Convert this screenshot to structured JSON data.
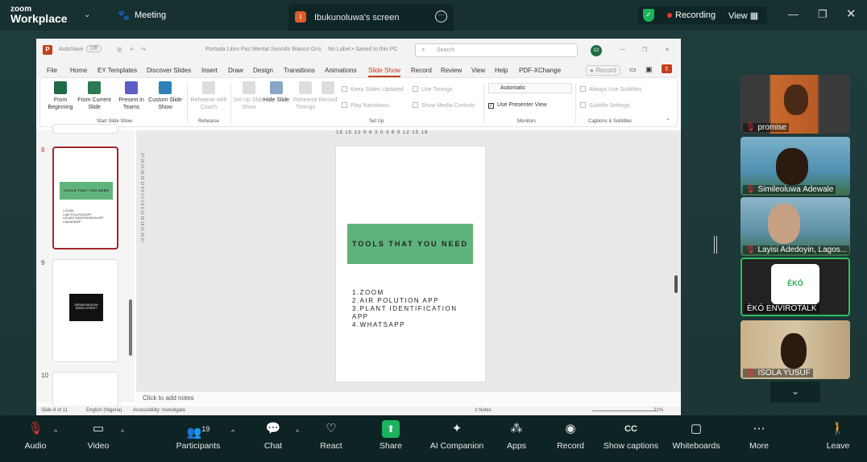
{
  "zoom": {
    "logo_line1": "zoom",
    "logo_line2": "Workplace",
    "meeting_label": "Meeting",
    "share_tab_title": "Ibukunoluwa's screen",
    "share_tab_initial": "I",
    "recording_label": "Recording",
    "view_label": "View"
  },
  "ppt": {
    "autosave": "AutoSave",
    "autosave_state": "Off",
    "doc_title": "Portada Libro Paz Mental Sencillo Blanco Gris",
    "label_status": "No Label • Saved to this PC",
    "search_placeholder": "Search",
    "user_initials": "IO",
    "record_btn": "Record",
    "menus": [
      "File",
      "Home",
      "EY Templates",
      "Discover Slides",
      "Insert",
      "Draw",
      "Design",
      "Transitions",
      "Animations",
      "Slide Show",
      "Record",
      "Review",
      "View",
      "Help",
      "PDF-XChange"
    ],
    "active_menu": "Slide Show",
    "ribbon": {
      "from_beginning": "From Beginning",
      "from_current": "From Current Slide",
      "present_teams": "Present in Teams",
      "custom_show": "Custom Slide Show",
      "group_start": "Start Slide Show",
      "rehearse_coach": "Rehearse with Coach",
      "group_rehearse": "Rehearse",
      "setup_show": "Set Up Slide Show",
      "hide_slide": "Hide Slide",
      "rehearse_timings": "Rehearse Timings",
      "record": "Record",
      "keep_updated": "Keep Slides Updated",
      "play_narrations": "Play Narrations",
      "use_timings": "Use Timings",
      "show_media": "Show Media Controls",
      "group_setup": "Set Up",
      "monitor_select": "Automatic",
      "presenter_view": "Use Presenter View",
      "group_monitors": "Monitors",
      "always_subtitles": "Always Use Subtitles",
      "subtitle_settings": "Subtitle Settings",
      "group_captions": "Captions & Subtitles"
    },
    "thumb_numbers": [
      "8",
      "9",
      "10"
    ],
    "thumb8_title": "TOOLS THAT YOU NEED",
    "thumb9_text": "ORGAN PAVILION ESSEX STREET",
    "slide_title": "TOOLS THAT YOU NEED",
    "slide_items": [
      "1.ZOOM",
      "2.AIR POLUTION APP",
      "3.PLANT IDENTIFICATION APP",
      "4.WHATSAPP"
    ],
    "ruler_h": "18 15 12 9 6 3 0 3 6 9 12 15 18",
    "ruler_v": "27 24 21 18 15 12 9 6 3 0 3 6 9 12 15 18 21 24 27",
    "notes_placeholder": "Click to add notes",
    "status_slide": "Slide 8 of 11",
    "status_lang": "English (Nigeria)",
    "status_access": "Accessibility: Investigate",
    "status_notes": "Notes",
    "status_zoom": "21%"
  },
  "participants": [
    {
      "name": "promise"
    },
    {
      "name": "Simileoluwa Adewale"
    },
    {
      "name": "Layisi Adedoyin, Lagos..."
    },
    {
      "name": "ÈKÓ ENVIROTALK"
    },
    {
      "name": "ISOLA YUSUF"
    }
  ],
  "toolbar": {
    "audio": "Audio",
    "video": "Video",
    "participants": "Participants",
    "participants_count": "19",
    "chat": "Chat",
    "react": "React",
    "share": "Share",
    "ai": "AI Companion",
    "apps": "Apps",
    "record": "Record",
    "captions": "Show captions",
    "whiteboards": "Whiteboards",
    "more": "More",
    "leave": "Leave"
  },
  "colors": {
    "accent_green": "#1bb35d",
    "ppt_red": "#c43e1c",
    "slide_green": "#5eb47a",
    "leave_red": "#e33"
  }
}
